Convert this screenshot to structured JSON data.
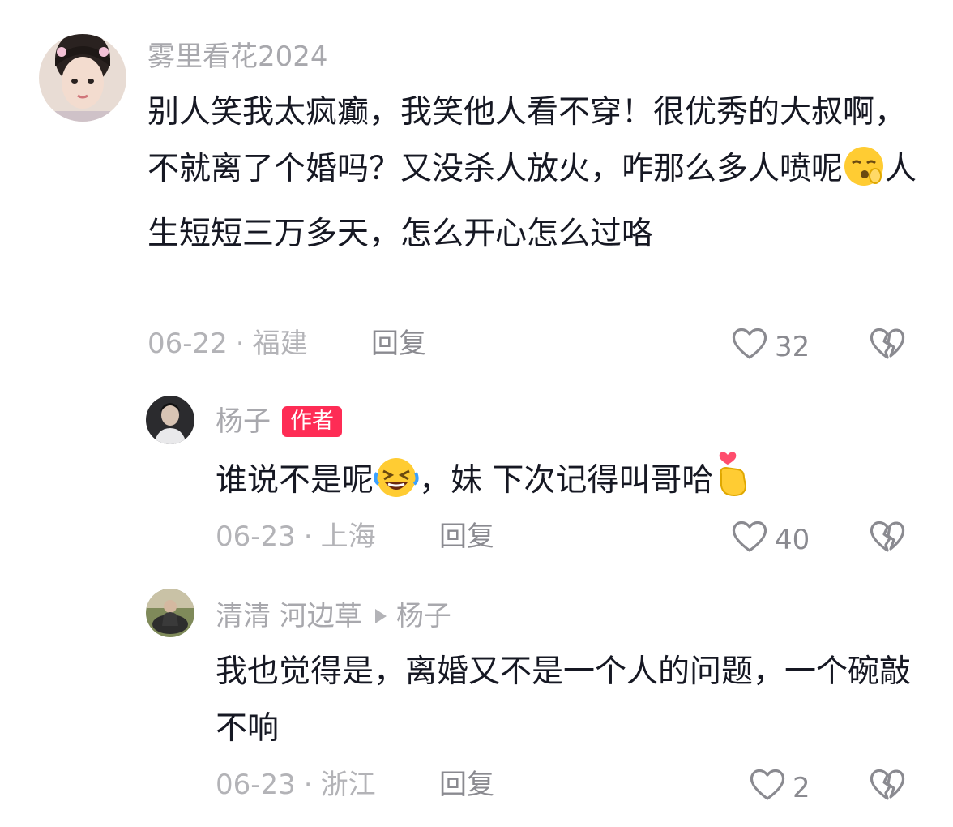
{
  "comments": [
    {
      "username": "雾里看花2024",
      "text": "别人笑我太疯癫，我笑他人看不穿！很优秀的大叔啊，不就离了个婚吗？又没杀人放火，咋那么多人喷呢",
      "text_after_emoji": "人生短短三万多天，怎么开心怎么过咯",
      "emoji": "sleepy-face-emoji",
      "date": "06-22",
      "location": "福建",
      "reply_label": "回复",
      "likes": "32"
    },
    {
      "username": "杨子",
      "badge": "作者",
      "text_before": "谁说不是呢",
      "text_middle": "，妹 下次记得叫哥哈",
      "emoji1": "rolling-laughing-emoji",
      "emoji2": "finger-heart-emoji",
      "date": "06-23",
      "location": "上海",
      "reply_label": "回复",
      "likes": "40"
    },
    {
      "username": "清清 河边草",
      "reply_to": "杨子",
      "text": "我也觉得是，离婚又不是一个人的问题，一个碗敲不响",
      "date": "06-23",
      "location": "浙江",
      "reply_label": "回复",
      "likes": "2"
    }
  ],
  "separator_dot": "·",
  "colors": {
    "accent": "#fe2c55",
    "text": "#161823",
    "muted": "#a8a8ad"
  }
}
